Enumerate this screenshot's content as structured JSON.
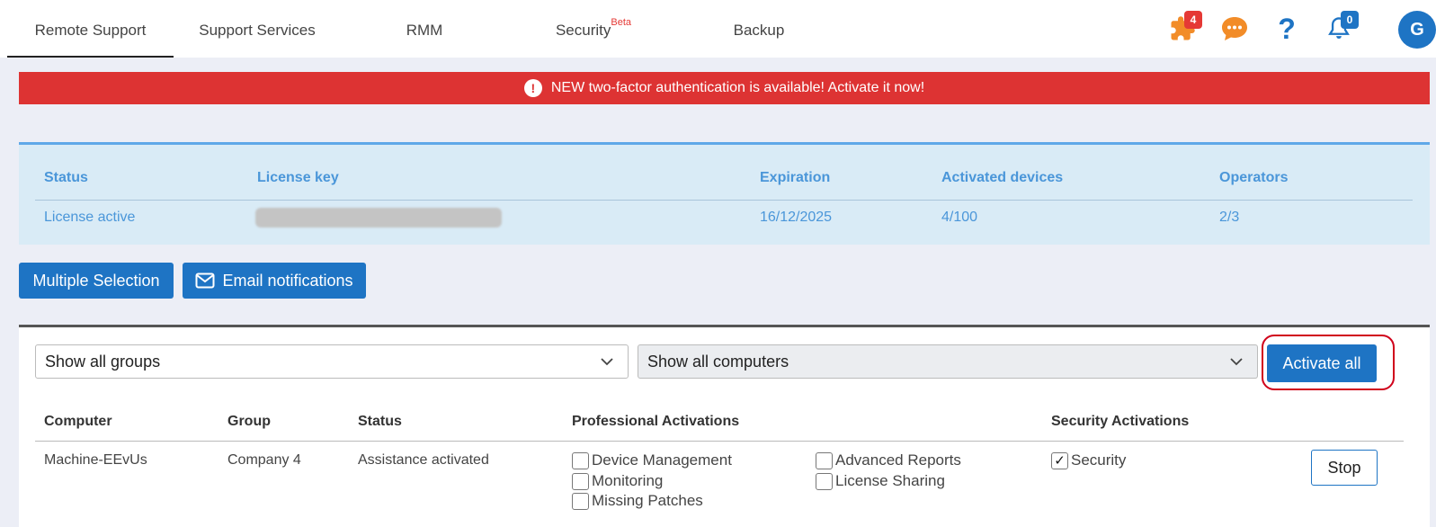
{
  "nav": {
    "tabs": [
      {
        "label": "Remote Support",
        "active": true
      },
      {
        "label": "Support Services",
        "active": false
      },
      {
        "label": "RMM",
        "active": false
      },
      {
        "label": "Security",
        "sup": "Beta",
        "active": false
      },
      {
        "label": "Backup",
        "active": false
      }
    ],
    "icons": {
      "puzzle_badge": "4",
      "bell_badge": "0",
      "help_glyph": "?",
      "avatar_letter": "G"
    },
    "colors": {
      "brand": "#1e74c4",
      "alert": "#dd3333",
      "puzzle": "#f28c28"
    }
  },
  "alert": {
    "icon_glyph": "!",
    "text": "NEW two-factor authentication is available! Activate it now!"
  },
  "license": {
    "headers": {
      "status": "Status",
      "key": "License key",
      "expiration": "Expiration",
      "devices": "Activated devices",
      "operators": "Operators"
    },
    "row": {
      "status": "License active",
      "expiration": "16/12/2025",
      "devices": "4/100",
      "operators": "2/3"
    }
  },
  "actions": {
    "multiple_selection": "Multiple Selection",
    "email_notifications": "Email notifications"
  },
  "filters": {
    "groups_selected": "Show all groups",
    "computers_selected": "Show all computers",
    "activate_all": "Activate all"
  },
  "table": {
    "headers": {
      "computer": "Computer",
      "group": "Group",
      "status": "Status",
      "professional": "Professional Activations",
      "security": "Security Activations"
    },
    "rows": [
      {
        "computer": "Machine-EEvUs",
        "group": "Company 4",
        "status": "Assistance activated",
        "professional": {
          "device_management": {
            "label": "Device Management",
            "checked": false
          },
          "monitoring": {
            "label": "Monitoring",
            "checked": false
          },
          "missing_patches": {
            "label": "Missing Patches",
            "checked": false
          },
          "advanced_reports": {
            "label": "Advanced Reports",
            "checked": false
          },
          "license_sharing": {
            "label": "License Sharing",
            "checked": false
          }
        },
        "security": {
          "label": "Security",
          "checked": true,
          "check_glyph": "✓"
        },
        "action": "Stop"
      }
    ]
  }
}
